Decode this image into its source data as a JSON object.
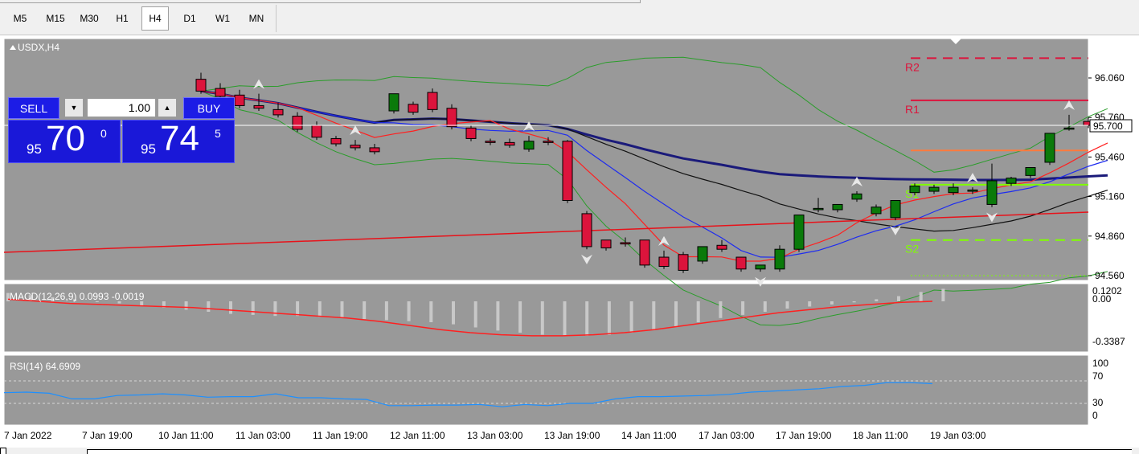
{
  "timeframes": [
    "M5",
    "M15",
    "M30",
    "H1",
    "H4",
    "D1",
    "W1",
    "MN"
  ],
  "active_timeframe": "H4",
  "chart": {
    "symbol_label": "USDX,H4",
    "price_axis": [
      "96.060",
      "95.760",
      "95.460",
      "95.160",
      "94.860",
      "94.560"
    ],
    "current_price": "95.700",
    "pivot_labels": [
      "R2",
      "R1",
      "S1",
      "S2"
    ],
    "time_axis": [
      "7 Jan 2022",
      "7 Jan 19:00",
      "10 Jan 11:00",
      "11 Jan 03:00",
      "11 Jan 19:00",
      "12 Jan 11:00",
      "13 Jan 03:00",
      "13 Jan 19:00",
      "14 Jan 11:00",
      "17 Jan 03:00",
      "17 Jan 19:00",
      "18 Jan 11:00",
      "19 Jan 03:00"
    ],
    "macd_label": "MACD(12,26,9) 0.0993 -0.0019",
    "macd_axis": [
      "0.1202",
      "0.00",
      "-0.3387"
    ],
    "rsi_label": "RSI(14) 64.6909",
    "rsi_axis": [
      "100",
      "70",
      "30",
      "0"
    ],
    "colors": {
      "bull": "#0a7a0a",
      "bear": "#dc143c",
      "background": "#999999",
      "ma_slow": "#1a1a7a",
      "ma_fast": "#ff2020",
      "bollinger": "#2a9d2a"
    }
  },
  "chart_data": {
    "type": "candlestick",
    "symbol": "USDX",
    "timeframe": "H4",
    "candles": [
      {
        "o": 96.05,
        "h": 96.1,
        "c": 95.96
      },
      {
        "o": 95.98,
        "h": 96.02,
        "c": 95.92
      },
      {
        "o": 95.93,
        "h": 95.97,
        "c": 95.85
      },
      {
        "o": 95.85,
        "h": 95.94,
        "c": 95.83
      },
      {
        "o": 95.82,
        "h": 95.87,
        "c": 95.78
      },
      {
        "o": 95.77,
        "h": 95.8,
        "c": 95.67
      },
      {
        "o": 95.7,
        "h": 95.73,
        "c": 95.61
      },
      {
        "o": 95.6,
        "h": 95.62,
        "c": 95.56
      },
      {
        "o": 95.55,
        "h": 95.59,
        "c": 95.53
      },
      {
        "o": 95.53,
        "h": 95.56,
        "c": 95.5
      },
      {
        "o": 95.81,
        "h": 95.83,
        "c": 95.94
      },
      {
        "o": 95.86,
        "h": 95.88,
        "c": 95.8
      },
      {
        "o": 95.95,
        "h": 95.98,
        "c": 95.82
      },
      {
        "o": 95.83,
        "h": 95.86,
        "c": 95.69
      },
      {
        "o": 95.68,
        "h": 95.7,
        "c": 95.6
      },
      {
        "o": 95.58,
        "h": 95.6,
        "c": 95.57
      },
      {
        "o": 95.57,
        "h": 95.6,
        "c": 95.55
      },
      {
        "o": 95.52,
        "h": 95.62,
        "c": 95.58
      },
      {
        "o": 95.58,
        "h": 95.61,
        "c": 95.57
      },
      {
        "o": 95.58,
        "h": 95.59,
        "c": 95.13
      },
      {
        "o": 95.03,
        "h": 95.05,
        "c": 94.78
      },
      {
        "o": 94.83,
        "h": 94.83,
        "c": 94.77
      },
      {
        "o": 94.81,
        "h": 94.85,
        "c": 94.8
      },
      {
        "o": 94.83,
        "h": 94.83,
        "c": 94.64
      },
      {
        "o": 94.7,
        "h": 94.75,
        "c": 94.63
      },
      {
        "o": 94.72,
        "h": 94.74,
        "c": 94.6
      },
      {
        "o": 94.67,
        "h": 94.76,
        "c": 94.78
      },
      {
        "o": 94.79,
        "h": 94.83,
        "c": 94.76
      },
      {
        "o": 94.7,
        "h": 94.7,
        "c": 94.61
      },
      {
        "o": 94.61,
        "h": 94.64,
        "c": 94.64
      },
      {
        "o": 94.61,
        "h": 94.79,
        "c": 94.76
      },
      {
        "o": 94.76,
        "h": 95.01,
        "c": 95.02
      },
      {
        "o": 95.06,
        "h": 95.15,
        "c": 95.07
      },
      {
        "o": 95.06,
        "h": 95.1,
        "c": 95.1
      },
      {
        "o": 95.14,
        "h": 95.2,
        "c": 95.18
      },
      {
        "o": 95.03,
        "h": 95.1,
        "c": 95.08
      },
      {
        "o": 95.0,
        "h": 95.1,
        "c": 95.13
      },
      {
        "o": 95.19,
        "h": 95.26,
        "c": 95.24
      },
      {
        "o": 95.2,
        "h": 95.25,
        "c": 95.23
      },
      {
        "o": 95.19,
        "h": 95.26,
        "c": 95.23
      },
      {
        "o": 95.2,
        "h": 95.23,
        "c": 95.21
      },
      {
        "o": 95.1,
        "h": 95.41,
        "c": 95.28
      },
      {
        "o": 95.26,
        "h": 95.31,
        "c": 95.3
      },
      {
        "o": 95.32,
        "h": 95.36,
        "c": 95.38
      },
      {
        "o": 95.42,
        "h": 95.62,
        "c": 95.64
      },
      {
        "o": 95.68,
        "h": 95.78,
        "c": 95.68
      },
      {
        "o": 95.73,
        "h": 95.76,
        "c": 95.7
      },
      {
        "o": 95.72,
        "h": 95.74,
        "c": 95.7
      }
    ],
    "ylim": [
      94.5,
      96.3
    ],
    "rsi": [
      49,
      50,
      48,
      38,
      38,
      44,
      45,
      47,
      45,
      41,
      42,
      42,
      47,
      40,
      40,
      38,
      37,
      26,
      26,
      27,
      27,
      28,
      24,
      28,
      26,
      30,
      30,
      38,
      42,
      42,
      43,
      44,
      46,
      50,
      52,
      54,
      56,
      60,
      62,
      67,
      67,
      65
    ],
    "macd_hist": [
      0.08,
      0.06,
      0.04,
      0.02,
      0.0,
      -0.02,
      -0.04,
      -0.06,
      -0.08,
      -0.1,
      -0.12,
      -0.13,
      -0.14,
      -0.14,
      -0.15,
      -0.16,
      -0.17,
      -0.18,
      -0.19,
      -0.2,
      -0.22,
      -0.25,
      -0.28,
      -0.3,
      -0.32,
      -0.33,
      -0.33,
      -0.32,
      -0.3,
      -0.27,
      -0.24,
      -0.2,
      -0.16,
      -0.13,
      -0.1,
      -0.07,
      -0.05,
      -0.03,
      -0.01,
      0.02,
      0.05,
      0.09,
      0.12
    ],
    "macd_signal": [
      0.02,
      0.0,
      -0.02,
      -0.03,
      -0.04,
      -0.05,
      -0.06,
      -0.08,
      -0.1,
      -0.12,
      -0.14,
      -0.16,
      -0.19,
      -0.23,
      -0.27,
      -0.3,
      -0.32,
      -0.33,
      -0.33,
      -0.32,
      -0.3,
      -0.27,
      -0.23,
      -0.19,
      -0.15,
      -0.11,
      -0.08,
      -0.05,
      -0.03,
      -0.01,
      0.0
    ]
  }
}
